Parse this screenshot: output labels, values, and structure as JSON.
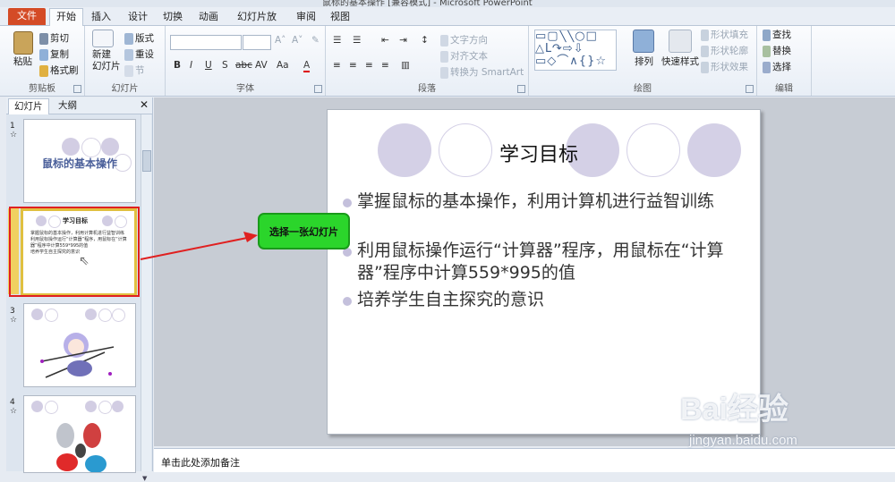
{
  "window": {
    "title": "鼠标的基本操作 [兼容模式] - Microsoft PowerPoint"
  },
  "tabs": [
    "文件",
    "开始",
    "插入",
    "设计",
    "切换",
    "动画",
    "幻灯片放映",
    "审阅",
    "视图"
  ],
  "ribbon": {
    "clipboard": {
      "paste": "粘贴",
      "cut": "剪切",
      "copy": "复制",
      "format_painter": "格式刷",
      "label": "剪贴板"
    },
    "slides": {
      "new_slide": "新建\n幻灯片",
      "new_slide_l1": "新建",
      "new_slide_l2": "幻灯片",
      "layout": "版式",
      "reset": "重设",
      "section": "节",
      "label": "幻灯片"
    },
    "font": {
      "label": "字体",
      "bold": "B",
      "italic": "I",
      "underline": "U",
      "shadow": "S",
      "strike": "abc",
      "spacing": "AV",
      "case": "Aa",
      "color": "A"
    },
    "paragraph": {
      "text_direction": "文字方向",
      "align_text": "对齐文本",
      "smartart": "转换为 SmartArt",
      "label": "段落"
    },
    "drawing": {
      "arrange": "排列",
      "quick_styles": "快速样式",
      "fill": "形状填充",
      "outline": "形状轮廓",
      "effects": "形状效果",
      "label": "绘图"
    },
    "editing": {
      "find": "查找",
      "replace": "替换",
      "select": "选择",
      "label": "编辑"
    }
  },
  "panel": {
    "tabs": [
      "幻灯片",
      "大纲"
    ],
    "thumbs": [
      {
        "num": "1",
        "title": "鼠标的基本操作"
      },
      {
        "num": "2",
        "title": "学习目标",
        "lines": [
          "掌握鼠标的基本操作，利用计算机进行益智训练",
          "利用鼠标操作运行“计算器”程序，用鼠标在“计算器”程序中计算559*995的值",
          "培养学生自主探究的意识"
        ]
      },
      {
        "num": "3"
      },
      {
        "num": "4"
      }
    ]
  },
  "slide": {
    "title": "学习目标",
    "bullets": [
      "掌握鼠标的基本操作，利用计算机进行益智训练",
      "利用鼠标操作运行“计算器”程序，用鼠标在“计算器”程序中计算559*995的值",
      "培养学生自主探究的意识"
    ]
  },
  "callout": "选择一张幻灯片",
  "notes": "单击此处添加备注",
  "watermark": {
    "main": "Bai经验",
    "sub": "jingyan.baidu.com"
  }
}
